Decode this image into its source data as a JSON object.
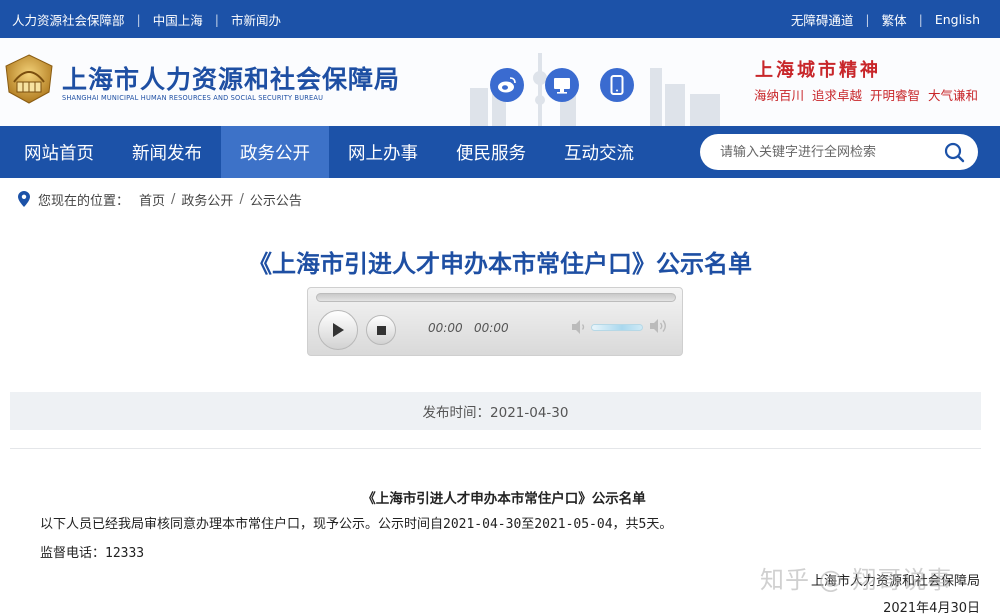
{
  "topbar": {
    "left_links": [
      "人力资源社会保障部",
      "中国上海",
      "市新闻办"
    ],
    "right_links": [
      "无障碍通道",
      "繁体",
      "English"
    ]
  },
  "header": {
    "title": "上海市人力资源和社会保障局",
    "subtitle": "SHANGHAI MUNICIPAL HUMAN RESOURCES AND SOCIAL SECURITY BUREAU",
    "spirit_title": "上海城市精神",
    "spirit_tags": [
      "海纳百川",
      "追求卓越",
      "开明睿智",
      "大气谦和"
    ]
  },
  "nav": {
    "items": [
      "网站首页",
      "新闻发布",
      "政务公开",
      "网上办事",
      "便民服务",
      "互动交流"
    ],
    "active": "政务公开",
    "search_placeholder": "请输入关键字进行全网检索"
  },
  "breadcrumb": {
    "label": "您现在的位置：",
    "items": [
      "首页",
      "政务公开",
      "公示公告"
    ]
  },
  "page_title": "《上海市引进人才申办本市常住户口》公示名单",
  "player": {
    "current_time": "00:00",
    "total_time": "00:00"
  },
  "publish": {
    "text": "发布时间：2021-04-30"
  },
  "article": {
    "heading": "《上海市引进人才申办本市常住户口》公示名单",
    "paragraph1": "以下人员已经我局审核同意办理本市常住户口，现予公示。公示时间自2021-04-30至2021-05-04，共5天。",
    "paragraph2": "监督电话：12333",
    "signer": "上海市人力资源和社会保障局",
    "date": "2021年4月30日"
  },
  "watermark": "知乎 @ 翔哥说事",
  "colors": {
    "primary": "#1c52a8",
    "nav_active": "#3d72c8",
    "title_blue": "#1e4fa3",
    "spirit_red": "#c8262a"
  }
}
